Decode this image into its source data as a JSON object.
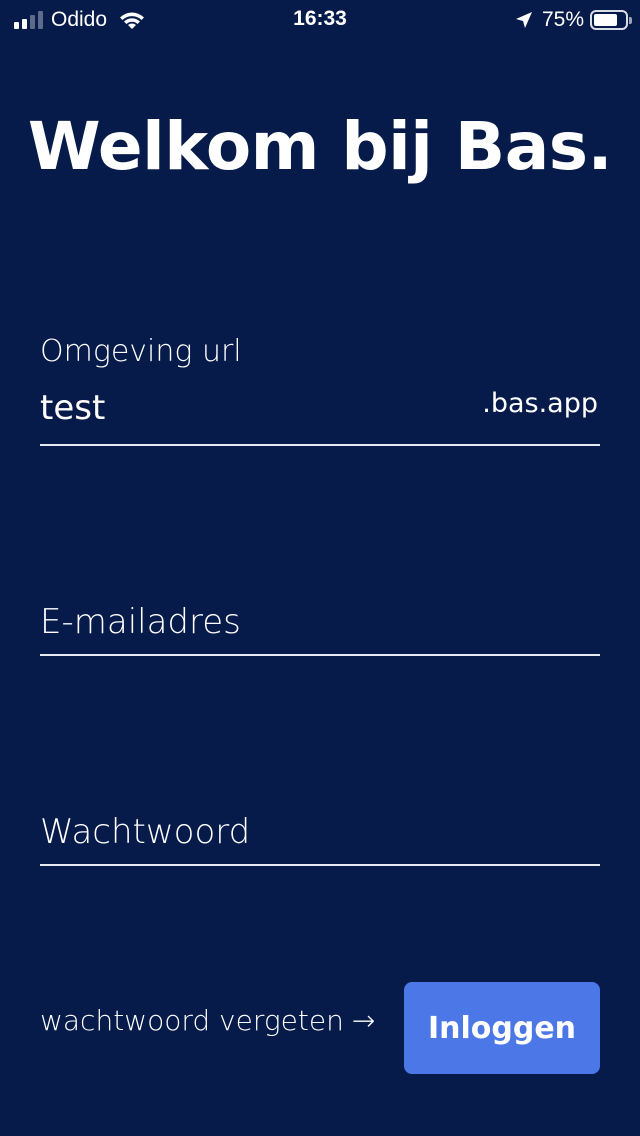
{
  "status_bar": {
    "carrier": "Odido",
    "time": "16:33",
    "battery_percent": "75%",
    "battery_level": 0.75,
    "signal_bars_active": 2,
    "signal_bars_total": 4
  },
  "title": "Welkom bij Bas.",
  "form": {
    "url_label": "Omgeving url",
    "url_value": "test",
    "url_suffix": ".bas.app",
    "email_placeholder": "E-mailadres",
    "password_placeholder": "Wachtwoord"
  },
  "actions": {
    "forgot_label": "wachtwoord vergeten",
    "forgot_arrow": "→",
    "login_label": "Inloggen"
  },
  "colors": {
    "background": "#071b4a",
    "button": "#4b78e6",
    "text": "#ffffff"
  }
}
